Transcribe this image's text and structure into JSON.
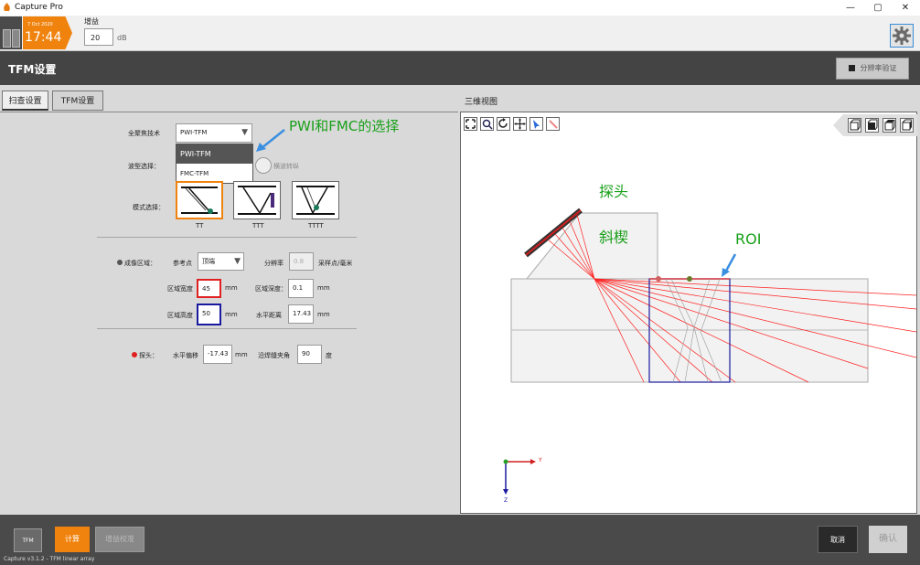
{
  "window": {
    "title": "Capture Pro",
    "minimize": "—",
    "maximize": "▢",
    "close": "✕"
  },
  "status_bar": {
    "date": "7 Oct 2020",
    "time": "17:44"
  },
  "gain": {
    "label": "增益",
    "value": "20",
    "unit": "dB"
  },
  "header": {
    "title": "TFM设置",
    "verify_button": "分辨率验证"
  },
  "tabs": [
    {
      "label": "扫查设置",
      "active": true
    },
    {
      "label": "TFM设置",
      "active": false
    }
  ],
  "scan": {
    "fmc_label": "全聚焦技术",
    "fmc_value": "PWI-TFM",
    "fmc_options": [
      "PWI-TFM",
      "FMC-TFM"
    ],
    "wave_label": "波型选择：",
    "wave_option_2": "横波转纵",
    "mode_label": "模式选择：",
    "modes": [
      "TT",
      "TTT",
      "TTTT"
    ],
    "imaging_label": "成像区域：",
    "ref_label": "参考点",
    "ref_value": "顶端",
    "resolution_label": "分辨率",
    "resolution_value": "0.8",
    "resolution_unit": "采样点/毫米",
    "width_label": "区域宽度",
    "width_value": "45",
    "depth_label": "区域深度：",
    "depth_value": "0.1",
    "height_label": "区域高度",
    "height_value": "50",
    "hdist_label": "水平距离",
    "hdist_value": "17.43",
    "unit_mm": "mm",
    "probe_label": "探头：",
    "hoffset_label": "水平偏移",
    "hoffset_value": "-17.43",
    "skew_label": "沿焊缝夹角",
    "skew_value": "90",
    "skew_unit": "度"
  },
  "annotations": {
    "fmc_note": "PWI和FMC的选择",
    "probe": "探头",
    "wedge": "斜楔",
    "roi": "ROI"
  },
  "view3d": {
    "title": "三维视图",
    "axis_y": "Y",
    "axis_z": "Z"
  },
  "bottom": {
    "tfm_btn": "TFM",
    "calc_btn": "计算",
    "gain_cal_btn": "增益校准",
    "cancel_btn": "取消",
    "confirm_btn": "确认",
    "status": "Capture v3.1.2 - TFM linear array"
  },
  "colors": {
    "accent": "#f0830e",
    "header": "#444444",
    "ray": "#ff0000",
    "roi": "#1a1aa0",
    "annotation": "#1aa01a"
  }
}
